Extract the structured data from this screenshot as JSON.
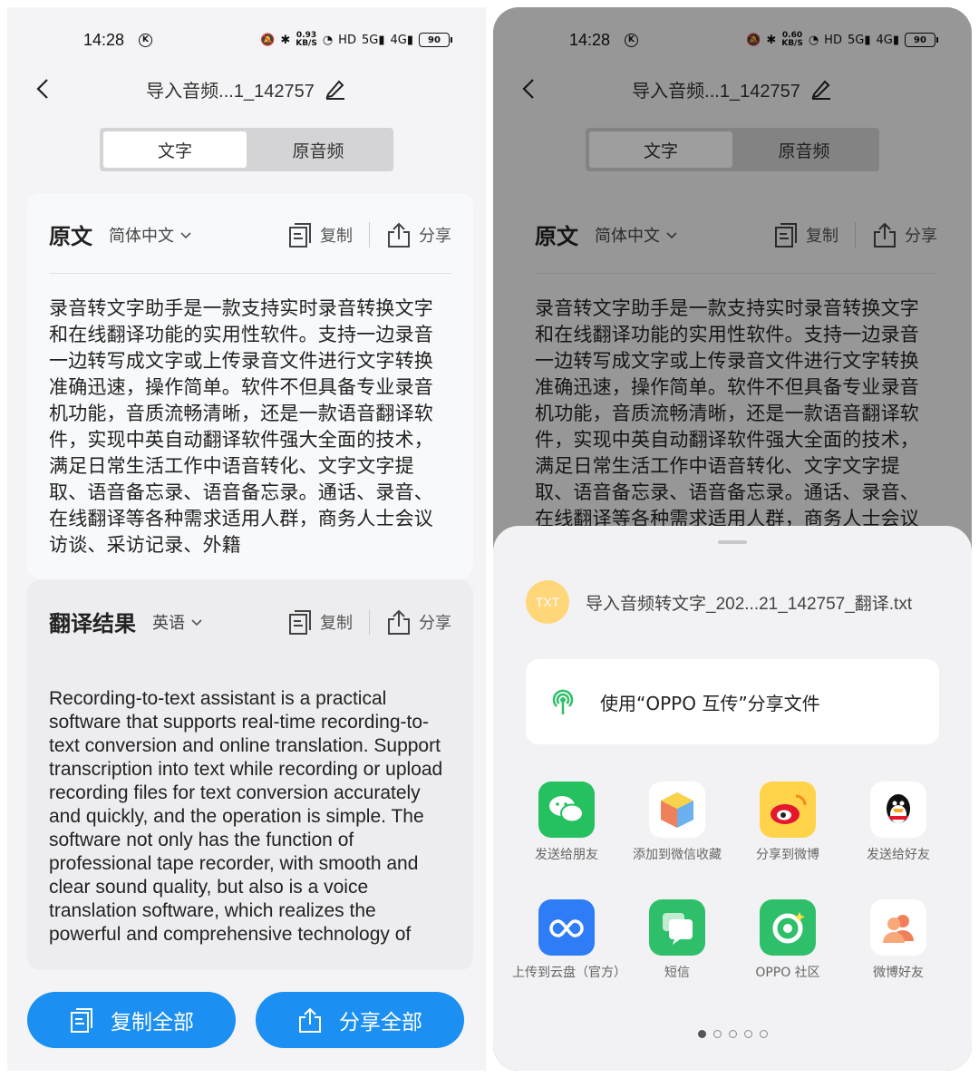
{
  "status": {
    "time": "14:28",
    "k_badge": "K",
    "net_left": "0.93\nKB/S",
    "net_right": "0.60\nKB/S",
    "hd": "HD",
    "sig1": "5G",
    "sig2": "4G",
    "battery": "90"
  },
  "header": {
    "title": "导入音频...1_142757"
  },
  "tabs": [
    {
      "label": "文字"
    },
    {
      "label": "原音频"
    }
  ],
  "original": {
    "title": "原文",
    "language": "简体中文",
    "copy_label": "复制",
    "share_label": "分享",
    "text": "录音转文字助手是一款支持实时录音转换文字和在线翻译功能的实用性软件。支持一边录音一边转写成文字或上传录音文件进行文字转换准确迅速，操作简单。软件不但具备专业录音机功能，音质流畅清晰，还是一款语音翻译软件，实现中英自动翻译软件强大全面的技术，满足日常生活工作中语音转化、文字文字提取、语音备忘录、语音备忘录。通话、录音、在线翻译等各种需求适用人群，商务人士会议访谈、采访记录、外籍"
  },
  "translation": {
    "title": "翻译结果",
    "language": "英语",
    "copy_label": "复制",
    "share_label": "分享",
    "text": "Recording-to-text assistant is a practical software that supports real-time recording-to-text conversion and online translation. Support transcription into text while recording or upload recording files for text conversion accurately and quickly, and the operation is simple. The software not only has the function of professional tape recorder, with smooth and clear sound quality, but also is a voice translation software, which realizes the powerful and comprehensive technology of"
  },
  "bottom": {
    "copy_all": "复制全部",
    "share_all": "分享全部"
  },
  "share_sheet": {
    "file_icon_text": "TXT",
    "file_name": "导入音频转文字_202...21_142757_翻译.txt",
    "oppo_share": "使用“OPPO 互传”分享文件",
    "apps": [
      {
        "label": "发送给朋友",
        "icon": "wechat-icon"
      },
      {
        "label": "添加到微信收藏",
        "icon": "wechat-favorites-icon"
      },
      {
        "label": "分享到微博",
        "icon": "weibo-icon"
      },
      {
        "label": "发送给好友",
        "icon": "qq-icon"
      },
      {
        "label": "上传到云盘（官方）",
        "icon": "cloud-drive-icon"
      },
      {
        "label": "短信",
        "icon": "messages-icon"
      },
      {
        "label": "OPPO 社区",
        "icon": "oppo-community-icon"
      },
      {
        "label": "微博好友",
        "icon": "weibo-friends-icon"
      }
    ],
    "page_count": 5,
    "page_current": 1
  },
  "colors": {
    "accent": "#1b8ff2",
    "file_icon": "#ffd77a",
    "oppo_green": "#2fbf6a"
  }
}
